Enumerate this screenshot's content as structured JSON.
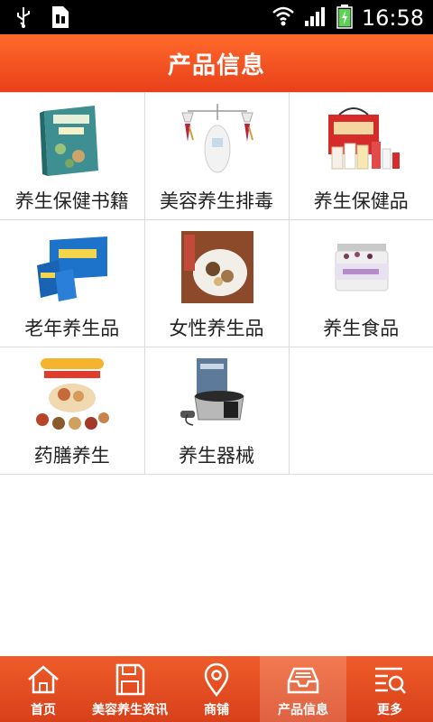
{
  "status_bar": {
    "time": "16:58"
  },
  "header": {
    "title": "产品信息"
  },
  "grid": {
    "items": [
      {
        "label": "养生保健书籍",
        "icon": "book-cover-image"
      },
      {
        "label": "美容养生排毒",
        "icon": "detox-device-image"
      },
      {
        "label": "养生保健品",
        "icon": "gift-box-image"
      },
      {
        "label": "老年养生品",
        "icon": "blue-box-image"
      },
      {
        "label": "女性养生品",
        "icon": "herbal-tea-bag-image"
      },
      {
        "label": "养生食品",
        "icon": "jar-image"
      },
      {
        "label": "药膳养生",
        "icon": "herbal-food-image"
      },
      {
        "label": "养生器械",
        "icon": "foot-massager-image"
      }
    ]
  },
  "tabbar": {
    "tabs": [
      {
        "label": "首页",
        "icon": "home-icon"
      },
      {
        "label": "美容养生资讯",
        "icon": "save-icon"
      },
      {
        "label": "商铺",
        "icon": "map-pin-icon"
      },
      {
        "label": "产品信息",
        "icon": "inbox-icon",
        "active": true
      },
      {
        "label": "更多",
        "icon": "list-search-icon"
      }
    ]
  },
  "colors": {
    "accent": "#e8401a",
    "header_top": "#ff6a2b"
  }
}
